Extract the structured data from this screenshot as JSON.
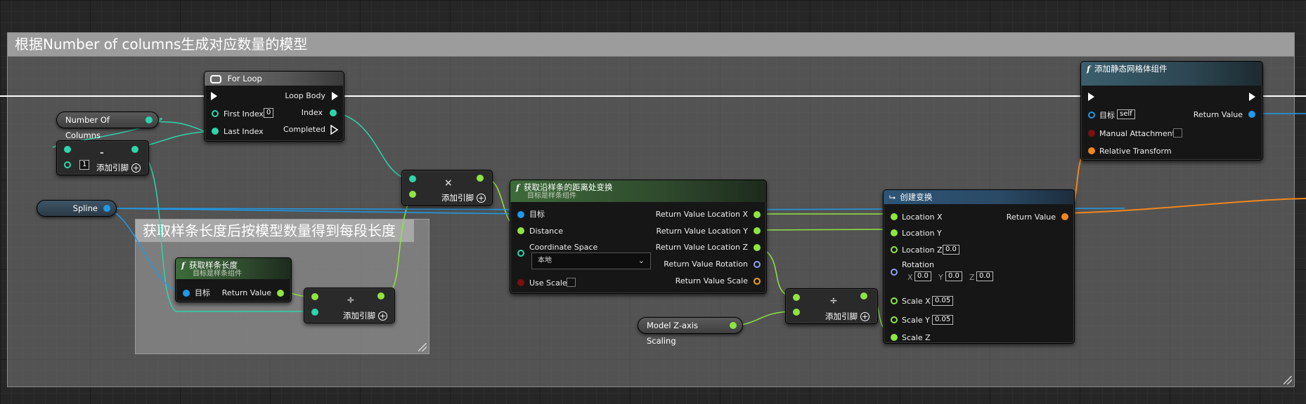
{
  "comments": {
    "main_title": "根据Number of columns生成对应数量的模型",
    "inner_title": "获取样条长度后按模型数量得到每段长度"
  },
  "variables": {
    "number_of_columns": "Number Of Columns",
    "spline": "Spline",
    "model_z_scaling": "Model Z-axis Scaling"
  },
  "subtract_node": {
    "symbol": "-",
    "default_value": "1",
    "add_pin": "添加引脚"
  },
  "for_loop": {
    "title": "For Loop",
    "loop_body": "Loop Body",
    "first_index": "First Index",
    "first_index_value": "0",
    "index": "Index",
    "last_index": "Last Index",
    "completed": "Completed"
  },
  "multiply_node": {
    "symbol": "×",
    "add_pin": "添加引脚"
  },
  "get_spline_length": {
    "title": "获取样条长度",
    "subtitle": "目标是样条组件",
    "target": "目标",
    "return_value": "Return Value"
  },
  "divide_node_1": {
    "symbol": "÷",
    "add_pin": "添加引脚"
  },
  "get_transform_at_distance": {
    "title": "获取沿样条的距离处变换",
    "subtitle": "目标是样条组件",
    "target": "目标",
    "distance": "Distance",
    "coordinate_space": "Coordinate Space",
    "coordinate_space_value": "本地",
    "use_scale": "Use Scale",
    "out_location_x": "Return Value Location X",
    "out_location_y": "Return Value Location Y",
    "out_location_z": "Return Value Location Z",
    "out_rotation": "Return Value Rotation",
    "out_scale": "Return Value Scale"
  },
  "divide_node_2": {
    "symbol": "÷",
    "add_pin": "添加引脚"
  },
  "make_transform": {
    "title": "创建变换",
    "location_x": "Location X",
    "location_y": "Location Y",
    "location_z": "Location Z",
    "location_z_value": "0.0",
    "rotation": "Rotation",
    "rot_x_label": "X",
    "rot_x": "0.0",
    "rot_y_label": "Y",
    "rot_y": "0.0",
    "rot_z_label": "Z",
    "rot_z": "0.0",
    "scale_x": "Scale X",
    "scale_x_value": "0.05",
    "scale_y": "Scale Y",
    "scale_y_value": "0.05",
    "scale_z": "Scale Z",
    "return_value": "Return Value"
  },
  "add_static_mesh": {
    "title": "添加静态网格体组件",
    "target": "目标",
    "target_value": "self",
    "return_value": "Return Value",
    "manual_attachment": "Manual Attachment",
    "relative_transform": "Relative Transform"
  },
  "colors": {
    "exec_wire": "#ffffff",
    "float_wire": "#8ee542",
    "int_wire": "#2dd5a9",
    "object_wire": "#1f9ae8",
    "transform_wire": "#f0861e",
    "function_header": "#3d6b3a",
    "comment_fill": "#9c9c9c"
  }
}
